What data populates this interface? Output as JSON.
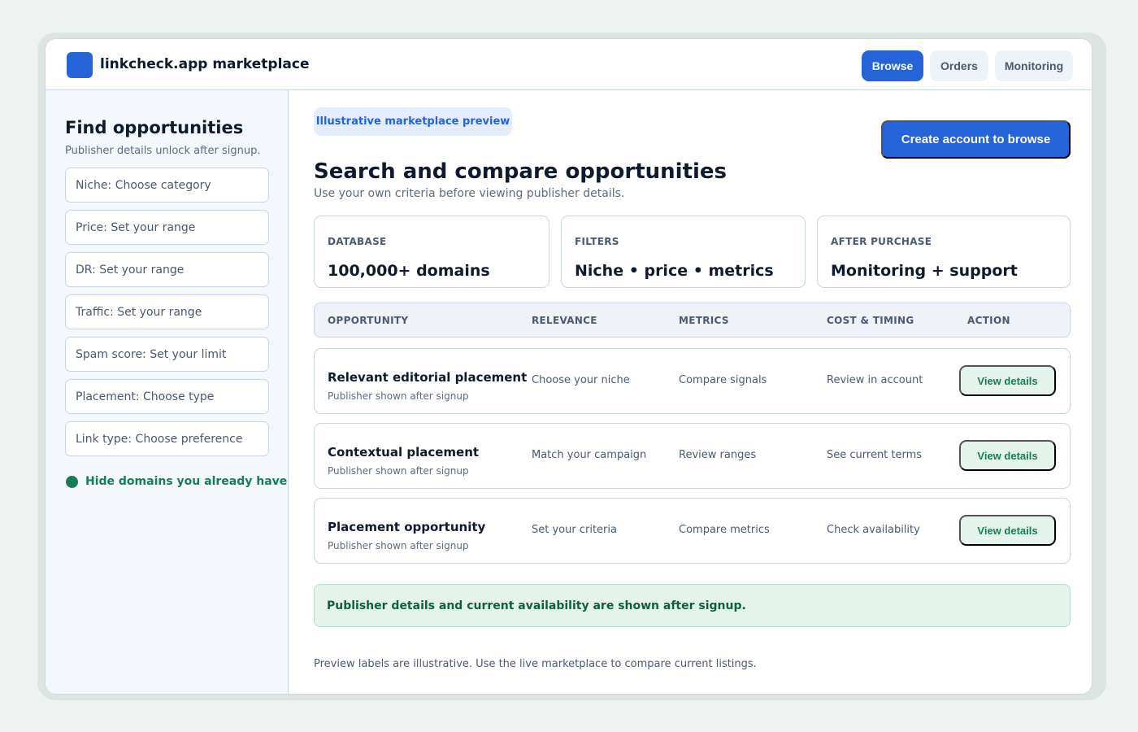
{
  "app": {
    "title": "linkcheck.app marketplace"
  },
  "nav": {
    "items": [
      "Browse",
      "Orders",
      "Monitoring"
    ],
    "active": "Browse"
  },
  "sidebar": {
    "title": "Find opportunities",
    "subtitle": "Publisher details unlock after signup.",
    "filters": [
      "Niche: Choose category",
      "Price: Set your range",
      "DR: Set your range",
      "Traffic: Set your range",
      "Spam score: Set your limit",
      "Placement: Choose type",
      "Link type: Choose preference"
    ],
    "hide_toggle": {
      "label": "Hide domains you already have",
      "checked": true
    }
  },
  "main": {
    "badge": "Illustrative marketplace preview",
    "cta": "Create account to browse",
    "title": "Search and compare opportunities",
    "subtitle": "Use your own criteria before viewing publisher details.",
    "stats": [
      {
        "label": "DATABASE",
        "value": "100,000+ domains"
      },
      {
        "label": "FILTERS",
        "value": "Niche • price • metrics"
      },
      {
        "label": "AFTER PURCHASE",
        "value": "Monitoring + support"
      }
    ],
    "table": {
      "headers": [
        "OPPORTUNITY",
        "RELEVANCE",
        "METRICS",
        "COST & TIMING",
        "ACTION"
      ],
      "rows": [
        {
          "title": "Relevant editorial placement",
          "sub": "Publisher shown after signup",
          "relevance": "Choose your niche",
          "metrics": "Compare signals",
          "cost": "Review in account",
          "action": "View details"
        },
        {
          "title": "Contextual placement",
          "sub": "Publisher shown after signup",
          "relevance": "Match your campaign",
          "metrics": "Review ranges",
          "cost": "See current terms",
          "action": "View details"
        },
        {
          "title": "Placement opportunity",
          "sub": "Publisher shown after signup",
          "relevance": "Set your criteria",
          "metrics": "Compare metrics",
          "cost": "Check availability",
          "action": "View details"
        }
      ]
    },
    "notice": "Publisher details and current availability are shown after signup.",
    "footnote": "Preview labels are illustrative. Use the live marketplace to compare current listings."
  },
  "colors": {
    "accent": "#2563d9",
    "success": "#177d57",
    "success_bg": "#e4f4ec"
  }
}
